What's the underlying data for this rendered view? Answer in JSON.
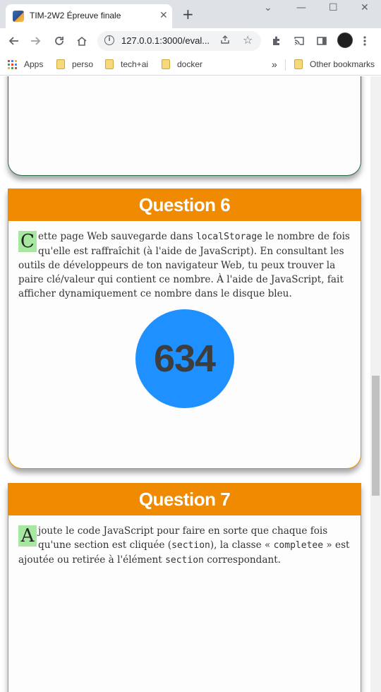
{
  "browser": {
    "tab_title": "TIM-2W2 Épreuve finale",
    "tab_close": "✕",
    "new_tab": "+",
    "url": "127.0.0.1:3000/eval...",
    "window_controls": [
      "⌄",
      "—",
      "☐",
      "✕"
    ],
    "avatar_icon": "profile-avatar"
  },
  "bookmarks": {
    "apps_label": "Apps",
    "items": [
      "perso",
      "tech+ai",
      "docker"
    ],
    "overflow": "»",
    "other_label": "Other bookmarks",
    "folder_color": "#f7d87b"
  },
  "questions": [
    {
      "heading": "Question 6",
      "dropcap": "C",
      "text_1": "ette page Web sauvegarde dans ",
      "code_1": "localStorage",
      "text_2": " le nombre de fois qu'elle est raffraîchit (à l'aide de JavaScript). En consultant les outils de développeurs de ton navigateur Web, tu peux trouver la paire clé/valeur qui contient ce nombre. À l'aide de JavaScript, fait afficher dynamiquement ce nombre dans le disque bleu.",
      "disk_value": "634",
      "disk_color": "#1e90ff"
    },
    {
      "heading": "Question 7",
      "dropcap": "A",
      "text_1": "joute le code JavaScript pour faire en sorte que chaque fois qu'une section est cliquée (",
      "code_1": "section",
      "text_2": "), la classe « ",
      "code_2": "completee",
      "text_3": " » est ajoutée ou retirée à l'élément ",
      "code_3": "section",
      "text_4": " correspondant."
    }
  ],
  "colors": {
    "header_orange": "#f08a00",
    "dropcap_green": "#a6e8a0",
    "prev_border": "#2e6b4a"
  }
}
